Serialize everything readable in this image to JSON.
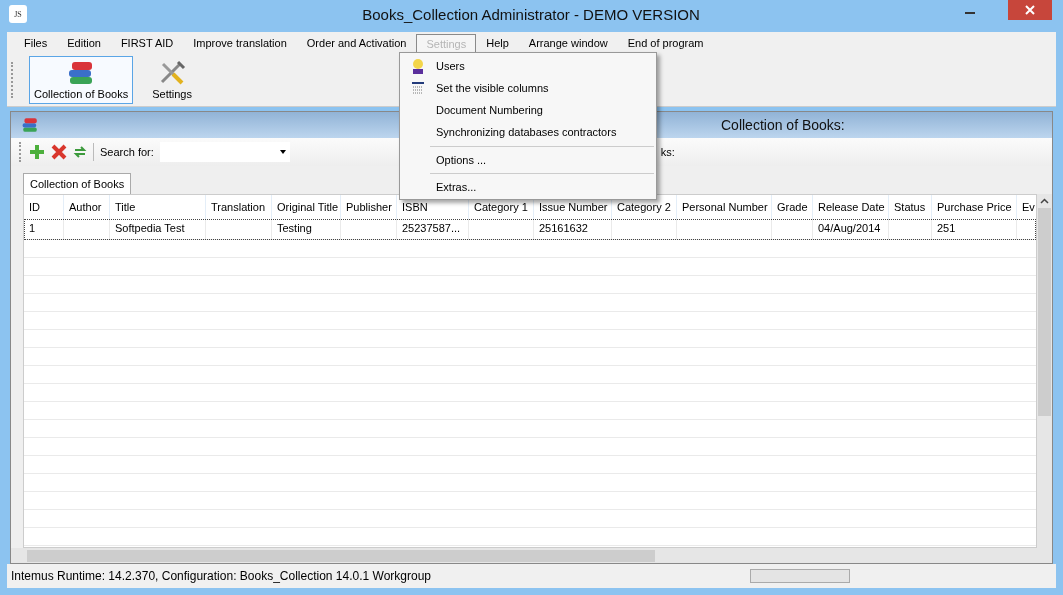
{
  "window": {
    "app_icon": "JS",
    "title": "Books_Collection  Administrator - DEMO VERSION"
  },
  "menu": [
    {
      "label": "Files",
      "selected": false
    },
    {
      "label": "Edition",
      "selected": false
    },
    {
      "label": "FIRST AID",
      "selected": false
    },
    {
      "label": "Improve translation",
      "selected": false
    },
    {
      "label": "Order and Activation",
      "selected": false
    },
    {
      "label": "Settings",
      "selected": true
    },
    {
      "label": "Help",
      "selected": false
    },
    {
      "label": "Arrange window",
      "selected": false
    },
    {
      "label": "End of program",
      "selected": false
    }
  ],
  "toolbar": [
    {
      "label": "Collection of Books",
      "kind": "books",
      "selected": true
    },
    {
      "label": "Settings",
      "kind": "tools",
      "selected": false
    }
  ],
  "dropdown": [
    [
      {
        "label": "Users",
        "kind": "user"
      },
      {
        "label": "Set the visible columns",
        "kind": "columns"
      },
      {
        "label": "Document Numbering",
        "kind": "plain"
      },
      {
        "label": "Synchronizing databases contractors",
        "kind": "plain"
      }
    ],
    [
      {
        "label": "Options ...",
        "kind": "plain"
      }
    ],
    [
      {
        "label": "Extras...",
        "kind": "plain"
      }
    ]
  ],
  "child_window": {
    "title": "Collection of Books:",
    "search_label": "Search for:",
    "covered_label": "ks:",
    "tabs": [
      {
        "label": "Collection of Books",
        "selected": true
      }
    ]
  },
  "table": {
    "columns": [
      "ID",
      "Author",
      "Title",
      "Translation",
      "Original Title",
      "Publisher",
      "ISBN",
      "Category 1",
      "Issue Number",
      "Category 2",
      "Personal Number",
      "Grade",
      "Release Date",
      "Status",
      "Purchase Price",
      "Ev"
    ],
    "rows": [
      {
        "selected": true,
        "cells": [
          "1",
          "",
          "Softpedia Test",
          "",
          "Testing",
          "",
          "25237587...",
          "",
          "25161632",
          "",
          "",
          "",
          "04/Aug/2014",
          "",
          "251",
          ""
        ]
      }
    ]
  },
  "status_bar": {
    "text": "Intemus Runtime: 14.2.370,  Configuration: Books_Collection 14.0.1 Workgroup",
    "progress": {
      "level": 0
    }
  }
}
